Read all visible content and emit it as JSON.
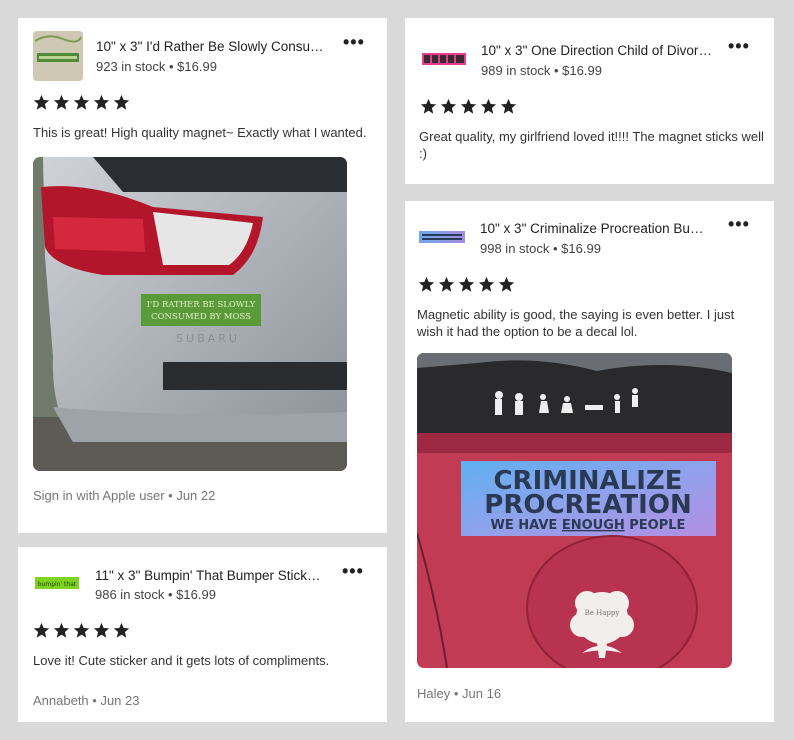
{
  "reviews": [
    {
      "product_title": "10\" x 3\" I'd Rather Be Slowly Consum...",
      "stock": "923 in stock",
      "price": "$16.99",
      "rating": 5,
      "text": "This is great! High quality magnet~ Exactly what I wanted.",
      "author": "Sign in with Apple user",
      "date": "Jun 22",
      "sticker_line1": "I'D RATHER BE SLOWLY",
      "sticker_line2": "CONSUMED BY MOSS",
      "car_badge": "SUBARU"
    },
    {
      "product_title": "11\" x 3\" Bumpin' That Bumper Sticker, ...",
      "stock": "986 in stock",
      "price": "$16.99",
      "rating": 5,
      "text": "Love it! Cute sticker and it gets lots of compliments.",
      "author": "Annabeth",
      "date": "Jun 23",
      "thumb_text": "bumpin' that"
    },
    {
      "product_title": "10\" x 3\" One Direction Child of Divorc...",
      "stock": "989 in stock",
      "price": "$16.99",
      "rating": 5,
      "text": "Great quality, my girlfriend loved it!!!! The magnet sticks well :)"
    },
    {
      "product_title": "10\" x 3\" Criminalize Procreation Bum...",
      "stock": "998 in stock",
      "price": "$16.99",
      "rating": 5,
      "text": "Magnetic ability is good, the saying is even better. I just wish it had the option to be a decal lol.",
      "author": "Haley",
      "date": "Jun 16",
      "sticker_line1": "CRIMINALIZE",
      "sticker_line2": "PROCREATION",
      "sticker_line3_pre": "WE HAVE ",
      "sticker_line3_em": "ENOUGH",
      "sticker_line3_post": " PEOPLE",
      "decal_text": "Be Happy"
    }
  ],
  "separator": " • ",
  "icons": {
    "star": "star-icon",
    "more": "more-options-icon"
  },
  "colors": {
    "background": "#d9d9d9",
    "card": "#ffffff",
    "star": "#222222",
    "moss_green": "#5a9a3a",
    "car_red": "#c23b55"
  }
}
